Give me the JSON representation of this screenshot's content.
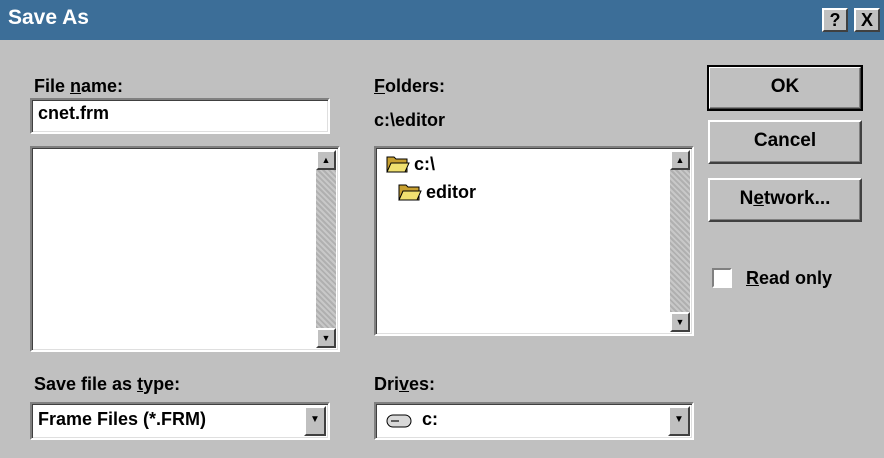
{
  "window": {
    "title": "Save As",
    "help_btn": "?",
    "close_btn": "X"
  },
  "file_name": {
    "label_pre": "File ",
    "label_accel": "n",
    "label_post": "ame:",
    "value": "cnet.frm",
    "list_items": []
  },
  "folders": {
    "label_accel": "F",
    "label_post": "olders:",
    "current_path": "c:\\editor",
    "items": [
      {
        "name": "c:\\",
        "icon": "open-folder-icon"
      },
      {
        "name": "editor",
        "icon": "open-folder-icon"
      }
    ]
  },
  "buttons": {
    "ok": "OK",
    "cancel": "Cancel",
    "network_pre": "N",
    "network_accel": "e",
    "network_post": "twork..."
  },
  "read_only": {
    "label_accel": "R",
    "label_post": "ead only",
    "checked": false
  },
  "save_type": {
    "label_pre": "Save file as ",
    "label_accel": "t",
    "label_post": "ype:",
    "selected": "Frame Files (*.FRM)"
  },
  "drives": {
    "label_pre": "Dri",
    "label_accel": "v",
    "label_post": "es:",
    "selected": "c:",
    "icon": "hard-drive-icon"
  },
  "colors": {
    "titlebar": "#3c6e98",
    "face": "#c0c0c0",
    "field": "#ffffff"
  }
}
